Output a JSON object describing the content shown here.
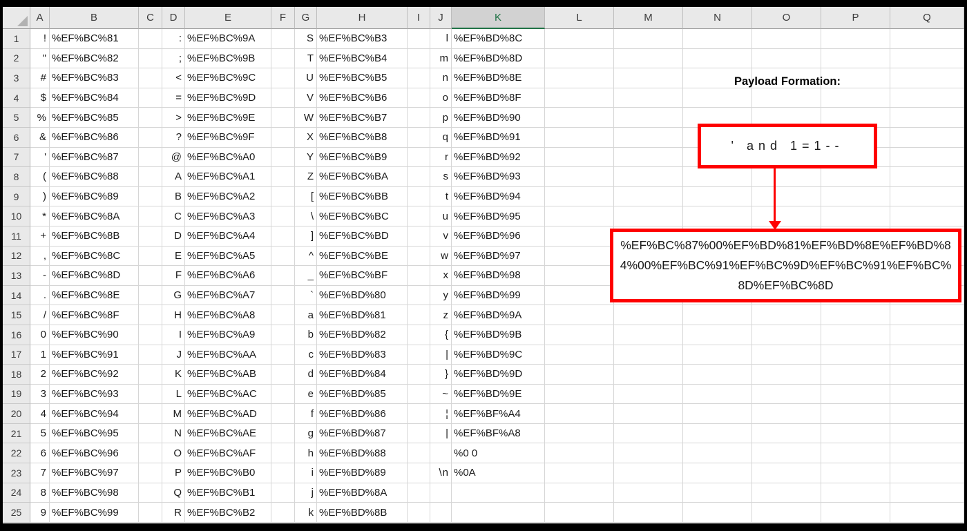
{
  "sheet": {
    "column_headers": [
      "A",
      "B",
      "C",
      "D",
      "E",
      "F",
      "G",
      "H",
      "I",
      "J",
      "K",
      "L",
      "M",
      "N",
      "O",
      "P",
      "Q"
    ],
    "selected_column": "K",
    "char_columns": [
      "A",
      "D",
      "G",
      "J"
    ],
    "code_columns": [
      "B",
      "E",
      "H",
      "K"
    ],
    "rows": [
      {
        "n": "1",
        "A": "!",
        "B": "%EF%BC%81",
        "D": ":",
        "E": "%EF%BC%9A",
        "G": "S",
        "H": "%EF%BC%B3",
        "J": "l",
        "K": "%EF%BD%8C"
      },
      {
        "n": "2",
        "A": "\"",
        "B": "%EF%BC%82",
        "D": ";",
        "E": "%EF%BC%9B",
        "G": "T",
        "H": "%EF%BC%B4",
        "J": "m",
        "K": "%EF%BD%8D"
      },
      {
        "n": "3",
        "A": "#",
        "B": "%EF%BC%83",
        "D": "<",
        "E": "%EF%BC%9C",
        "G": "U",
        "H": "%EF%BC%B5",
        "J": "n",
        "K": "%EF%BD%8E"
      },
      {
        "n": "4",
        "A": "$",
        "B": "%EF%BC%84",
        "D": "=",
        "E": "%EF%BC%9D",
        "G": "V",
        "H": "%EF%BC%B6",
        "J": "o",
        "K": "%EF%BD%8F"
      },
      {
        "n": "5",
        "A": "%",
        "B": "%EF%BC%85",
        "D": ">",
        "E": "%EF%BC%9E",
        "G": "W",
        "H": "%EF%BC%B7",
        "J": "p",
        "K": "%EF%BD%90"
      },
      {
        "n": "6",
        "A": "&",
        "B": "%EF%BC%86",
        "D": "?",
        "E": "%EF%BC%9F",
        "G": "X",
        "H": "%EF%BC%B8",
        "J": "q",
        "K": "%EF%BD%91"
      },
      {
        "n": "7",
        "A": "'",
        "B": "%EF%BC%87",
        "D": "@",
        "E": "%EF%BC%A0",
        "G": "Y",
        "H": "%EF%BC%B9",
        "J": "r",
        "K": "%EF%BD%92"
      },
      {
        "n": "8",
        "A": "(",
        "B": "%EF%BC%88",
        "D": "A",
        "E": "%EF%BC%A1",
        "G": "Z",
        "H": "%EF%BC%BA",
        "J": "s",
        "K": "%EF%BD%93"
      },
      {
        "n": "9",
        "A": ")",
        "B": "%EF%BC%89",
        "D": "B",
        "E": "%EF%BC%A2",
        "G": "[",
        "H": "%EF%BC%BB",
        "J": "t",
        "K": "%EF%BD%94"
      },
      {
        "n": "10",
        "A": "*",
        "B": "%EF%BC%8A",
        "D": "C",
        "E": "%EF%BC%A3",
        "G": "\\",
        "H": "%EF%BC%BC",
        "J": "u",
        "K": "%EF%BD%95"
      },
      {
        "n": "11",
        "A": "+",
        "B": "%EF%BC%8B",
        "D": "D",
        "E": "%EF%BC%A4",
        "G": "]",
        "H": "%EF%BC%BD",
        "J": "v",
        "K": "%EF%BD%96"
      },
      {
        "n": "12",
        "A": ",",
        "B": "%EF%BC%8C",
        "D": "E",
        "E": "%EF%BC%A5",
        "G": "^",
        "H": "%EF%BC%BE",
        "J": "w",
        "K": "%EF%BD%97"
      },
      {
        "n": "13",
        "A": "-",
        "B": "%EF%BC%8D",
        "D": "F",
        "E": "%EF%BC%A6",
        "G": "_",
        "H": "%EF%BC%BF",
        "J": "x",
        "K": "%EF%BD%98"
      },
      {
        "n": "14",
        "A": ".",
        "B": "%EF%BC%8E",
        "D": "G",
        "E": "%EF%BC%A7",
        "G": "`",
        "H": "%EF%BD%80",
        "J": "y",
        "K": "%EF%BD%99"
      },
      {
        "n": "15",
        "A": "/",
        "B": "%EF%BC%8F",
        "D": "H",
        "E": "%EF%BC%A8",
        "G": "a",
        "H": "%EF%BD%81",
        "J": "z",
        "K": "%EF%BD%9A"
      },
      {
        "n": "16",
        "A": "0",
        "B": "%EF%BC%90",
        "D": "I",
        "E": "%EF%BC%A9",
        "G": "b",
        "H": "%EF%BD%82",
        "J": "{",
        "K": "%EF%BD%9B"
      },
      {
        "n": "17",
        "A": "1",
        "B": "%EF%BC%91",
        "D": "J",
        "E": "%EF%BC%AA",
        "G": "c",
        "H": "%EF%BD%83",
        "J": "|",
        "K": "%EF%BD%9C"
      },
      {
        "n": "18",
        "A": "2",
        "B": "%EF%BC%92",
        "D": "K",
        "E": "%EF%BC%AB",
        "G": "d",
        "H": "%EF%BD%84",
        "J": "}",
        "K": "%EF%BD%9D"
      },
      {
        "n": "19",
        "A": "3",
        "B": "%EF%BC%93",
        "D": "L",
        "E": "%EF%BC%AC",
        "G": "e",
        "H": "%EF%BD%85",
        "J": "~",
        "K": "%EF%BD%9E"
      },
      {
        "n": "20",
        "A": "4",
        "B": "%EF%BC%94",
        "D": "M",
        "E": "%EF%BC%AD",
        "G": "f",
        "H": "%EF%BD%86",
        "J": "¦",
        "K": "%EF%BF%A4"
      },
      {
        "n": "21",
        "A": "5",
        "B": "%EF%BC%95",
        "D": "N",
        "E": "%EF%BC%AE",
        "G": "g",
        "H": "%EF%BD%87",
        "J": "|",
        "K": "%EF%BF%A8"
      },
      {
        "n": "22",
        "A": "6",
        "B": "%EF%BC%96",
        "D": "O",
        "E": "%EF%BC%AF",
        "G": "h",
        "H": "%EF%BD%88",
        "J": "",
        "K": "%0 0"
      },
      {
        "n": "23",
        "A": "7",
        "B": "%EF%BC%97",
        "D": "P",
        "E": "%EF%BC%B0",
        "G": "i",
        "H": "%EF%BD%89",
        "J": "\\n",
        "K": "%0A"
      },
      {
        "n": "24",
        "A": "8",
        "B": "%EF%BC%98",
        "D": "Q",
        "E": "%EF%BC%B1",
        "G": "j",
        "H": "%EF%BD%8A",
        "J": "",
        "K": ""
      },
      {
        "n": "25",
        "A": "9",
        "B": "%EF%BC%99",
        "D": "R",
        "E": "%EF%BC%B2",
        "G": "k",
        "H": "%EF%BD%8B",
        "J": "",
        "K": ""
      }
    ]
  },
  "annotation": {
    "title": "Payload Formation:",
    "payload_text": "' and 1=1--",
    "encoded_payload": "%EF%BC%87%00%EF%BD%81%EF%BD%8E%EF%BD%84%00%EF%BC%91%EF%BC%9D%EF%BC%91%EF%BC%8D%EF%BC%8D"
  },
  "colors": {
    "annotation_red": "#FE0000",
    "selected_header_green": "#217346",
    "header_bg": "#E9E9E9",
    "selected_header_bg": "#D2D2D2",
    "gridline": "#D6D6D6",
    "frame": "#000000"
  }
}
